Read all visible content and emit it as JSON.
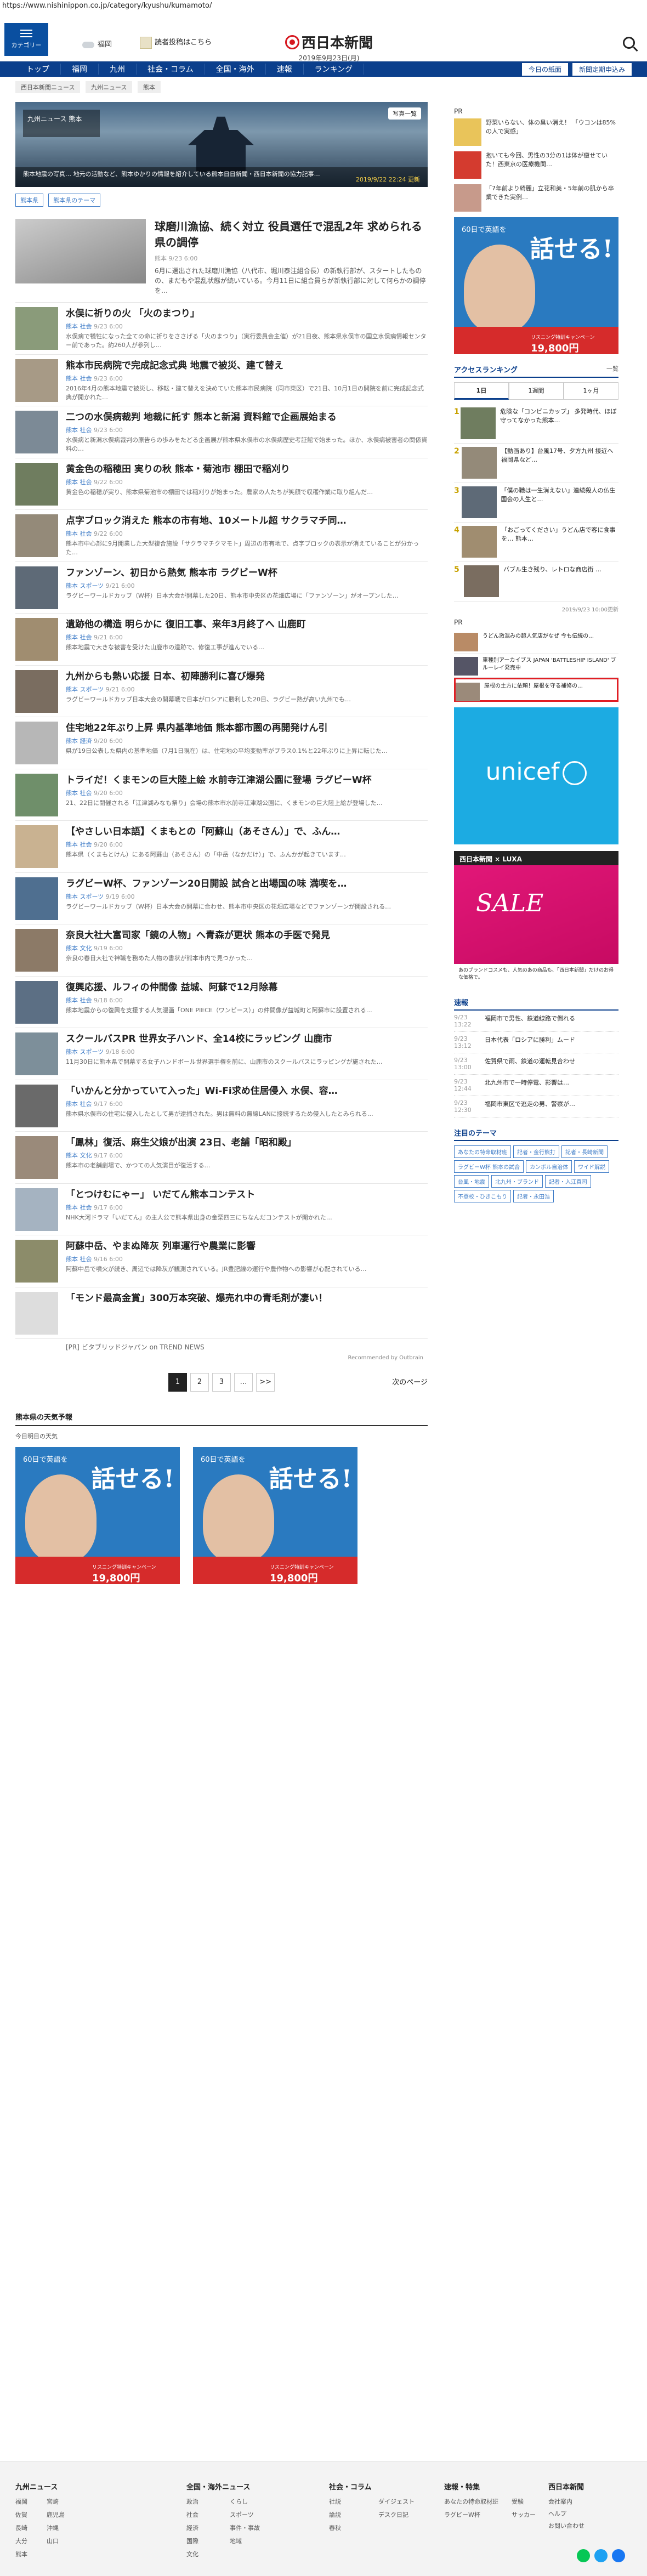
{
  "url": "https://www.nishinippon.co.jp/category/kyushu/kumamoto/",
  "header": {
    "category_label": "カテゴリー",
    "weather": "福岡",
    "ad_link": "読者投稿はこちら",
    "logo": "西日本新聞",
    "date": "2019年9月23日(月)"
  },
  "gnav": {
    "items": [
      "トップ",
      "福岡",
      "九州",
      "社会・コラム",
      "全国・海外",
      "速報",
      "ランキング"
    ],
    "right": [
      "今日の紙面",
      "新聞定期申込み"
    ]
  },
  "breadcrumb": [
    "西日本新聞ニュース",
    "九州ニュース",
    "熊本"
  ],
  "hero": {
    "tag": "九州ニュース 熊本",
    "photo_btn": "写真一覧",
    "caption": "熊本地震の写真… 地元の活動など、熊本ゆかりの情報を紹介している熊本日日新聞・西日本新聞の協力記事…",
    "date": "2019/9/22 22:24 更新"
  },
  "tags": [
    "熊本県",
    "熊本県のテーマ"
  ],
  "lead": {
    "title": "球磨川漁協、続く対立 役員選任で混乱2年 求められる県の調停",
    "meta": "熊本 9/23 6:00",
    "text": "6月に選出された球磨川漁協（八代市、堀川泰注組合長）の新執行部が、スタートしたものの、まだもや混乱状態が続いている。今月11日に組合員らが新執行部に対して何らかの調停を…"
  },
  "articles": [
    {
      "title": "水俣に祈りの火 「火のまつり」",
      "tag": "熊本",
      "cat": "社会",
      "time": "9/23 6:00",
      "text": "水俣病で犠牲になった全ての命に祈りをささげる「火のまつり」（実行委員会主催）が21日夜、熊本県水俣市の国立水俣病情報センター前であった。約260人が参列し…"
    },
    {
      "title": "熊本市民病院で完成記念式典 地震で被災、建て替え",
      "tag": "熊本",
      "cat": "社会",
      "time": "9/23 6:00",
      "text": "2016年4月の熊本地震で被災し、移転・建て替えを決めていた熊本市民病院（同市東区）で21日、10月1日の開院を前に完成記念式典が開かれた…"
    },
    {
      "title": "二つの水俣病裁判 地裁に託す 熊本と新潟 資料館で企画展始まる",
      "tag": "熊本",
      "cat": "社会",
      "time": "9/23 6:00",
      "text": "水俣病と新潟水俣病裁判の原告らの歩みをたどる企画展が熊本県水俣市の水俣病歴史考証館で始まった。ほか、水俣病被害者の関係資料の…"
    },
    {
      "title": "黄金色の稲穂田 実りの秋 熊本・菊池市 棚田で稲刈り",
      "tag": "熊本",
      "cat": "社会",
      "time": "9/22 6:00",
      "text": "黄金色の稲穂が実り、熊本県菊池市の棚田では稲刈りが始まった。農家の人たちが笑顔で収穫作業に取り組んだ…"
    },
    {
      "title": "点字ブロック消えた 熊本の市有地、10メートル超 サクラマチ同…",
      "tag": "熊本",
      "cat": "社会",
      "time": "9/22 6:00",
      "text": "熊本市中心部に9月開業した大型複合施設「サクラマチクマモト」周辺の市有地で、点字ブロックの表示が消えていることが分かった…"
    },
    {
      "title": "ファンゾーン、初日から熱気 熊本市 ラグビーW杯",
      "tag": "熊本",
      "cat": "スポーツ",
      "time": "9/21 6:00",
      "text": "ラグビーワールドカップ（W杯）日本大会が開幕した20日、熊本市中央区の花畑広場に「ファンゾーン」がオープンした…"
    },
    {
      "title": "遺跡他の構造 明らかに 復旧工事、来年3月終了へ 山鹿町",
      "tag": "熊本",
      "cat": "社会",
      "time": "9/21 6:00",
      "text": "熊本地震で大きな被害を受けた山鹿市の遺跡で、修復工事が進んでいる…"
    },
    {
      "title": "九州からも熱い応援 日本、初陣勝利に喜び爆発",
      "tag": "熊本",
      "cat": "スポーツ",
      "time": "9/21 6:00",
      "text": "ラグビーワールドカップ日本大会の開幕戦で日本がロシアに勝利した20日、ラグビー熱が高い九州でも…"
    },
    {
      "title": "住宅地22年ぶり上昇 県内基準地価 熊本都市圏の再開発けん引",
      "tag": "熊本",
      "cat": "経済",
      "time": "9/20 6:00",
      "text": "県が19日公表した県内の基準地価（7月1日現在）は、住宅地の平均変動率がプラス0.1%と22年ぶりに上昇に転じた…"
    },
    {
      "title": "トライだ！くまモンの巨大陸上絵 水前寺江津湖公園に登場 ラグビーW杯",
      "tag": "熊本",
      "cat": "社会",
      "time": "9/20 6:00",
      "text": "21、22日に開催される「江津湖みなも祭り」会場の熊本市水前寺江津湖公園に、くまモンの巨大陸上絵が登場した…"
    },
    {
      "title": "【やさしい日本語】くまもとの「阿蘇山（あそさん）」で、ふん…",
      "tag": "熊本",
      "cat": "社会",
      "time": "9/20 6:00",
      "text": "熊本県（くまもとけん）にある阿蘇山（あそさん）の「中岳（なかだけ）」で、ふんかが起きています…"
    },
    {
      "title": "ラグビーW杯、ファンゾーン20日開設 試合と出場国の味 満喫を…",
      "tag": "熊本",
      "cat": "スポーツ",
      "time": "9/19 6:00",
      "text": "ラグビーワールドカップ（W杯）日本大会の開幕に合わせ、熊本市中央区の花畑広場などでファンゾーンが開設される…"
    },
    {
      "title": "奈良大社大富司家「鏡の人物」へ青森が更状 熊本の手医で発見",
      "tag": "熊本",
      "cat": "文化",
      "time": "9/19 6:00",
      "text": "奈良の春日大社で神職を務めた人物の書状が熊本市内で見つかった…"
    },
    {
      "title": "復興応援、ルフィの仲間像 益城、阿蘇で12月除幕",
      "tag": "熊本",
      "cat": "社会",
      "time": "9/18 6:00",
      "text": "熊本地震からの復興を支援する人気漫画「ONE PIECE（ワンピース）」の仲間像が益城町と阿蘇市に設置される…"
    },
    {
      "title": "スクールバスPR 世界女子ハンド、全14校にラッピング 山鹿市",
      "tag": "熊本",
      "cat": "スポーツ",
      "time": "9/18 6:00",
      "text": "11月30日に熊本県で開幕する女子ハンドボール世界選手権を前に、山鹿市のスクールバスにラッピングが施された…"
    },
    {
      "title": "「いかんと分かっていて入った」Wi-Fi求め住居侵入 水俣、容…",
      "tag": "熊本",
      "cat": "社会",
      "time": "9/17 6:00",
      "text": "熊本県水俣市の住宅に侵入したとして男が逮捕された。男は無料の無線LANに接続するため侵入したとみられる…"
    },
    {
      "title": "「鳳林」復活、麻生父娘が出演 23日、老舗「昭和殿」",
      "tag": "熊本",
      "cat": "文化",
      "time": "9/17 6:00",
      "text": "熊本市の老舗劇場で、かつての人気演目が復活する…"
    },
    {
      "title": "「とつけむにゃー」 いだてん熊本コンテスト",
      "tag": "熊本",
      "cat": "社会",
      "time": "9/17 6:00",
      "text": "NHK大河ドラマ「いだてん」の主人公で熊本県出身の金栗四三にちなんだコンテストが開かれた…"
    },
    {
      "title": "阿蘇中岳、やまぬ降灰 列車運行や農業に影響",
      "tag": "熊本",
      "cat": "社会",
      "time": "9/16 6:00",
      "text": "阿蘇中岳で噴火が続き、周辺では降灰が観測されている。JR豊肥線の運行や農作物への影響が心配されている…"
    }
  ],
  "pr_article": {
    "title": "「モンド最高金賞」300万本突破、爆売れ中の青毛剤が凄い！",
    "source": "[PR] ビタブリッドジャパン on TREND NEWS"
  },
  "recommended": "Recommended by Outbrain",
  "pager": {
    "pages": [
      "1",
      "2",
      "3",
      "…",
      ">>"
    ],
    "next": "次のページ"
  },
  "pref": {
    "title": "熊本県の天気予報",
    "sub": "今日明日の天気"
  },
  "ad60": {
    "lead": "話せる!",
    "badge": "60日で英語を",
    "cta": "19,800円",
    "small": "リスニング特訓キャンペーン"
  },
  "side": {
    "pr_label": "PR",
    "pr_items": [
      "野菜いらない、体の臭い消え！ 「ウコンは85%の人で実感」",
      "抱いても今回、男性の3分の1は体が痩せていた！西東京の医療機関…",
      "「7年前より綺麗」立花和美・5年前の肌から卒業できた実例…"
    ],
    "ranking": {
      "title": "アクセスランキング",
      "more": "一覧",
      "tabs": [
        "1日",
        "1週間",
        "1ヶ月"
      ],
      "items": [
        "危険な「コンビニカップ」 多発時代、ほぼ守ってなかった熊本…",
        "【動画あり】台風17号、夕方九州 接近へ 福岡県など…",
        "「僕の職は一生消えない」連続殺人の仏生国会の人生と…",
        "「おごってください」うどん店で客に食事を… 熊本…",
        "バブル生き残り、レトロな商店街 …"
      ],
      "date": "2019/9/23 10:00更新"
    },
    "pr2": [
      "うどん激混みの超人気店がなぜ 今も伝統の…",
      "車種別アーカイブス JAPAN 'BATTLESHIP ISLAND' ブルーレイ発売中",
      "屋根の土方に依頼！屋根を守る補修の…"
    ],
    "unicef": "unicef",
    "luxa_head": "西日本新聞 × LUXA",
    "luxa_sale": "SALE",
    "luxa_foot": "あのブランドコスメも、人気のあの商品も、「西日本新聞」だけのお得な価格で。",
    "sokuho_title": "速報",
    "sokuho": [
      {
        "t": "9/23 13:22",
        "s": "福岡市で男性、鉄道線路で倒れる"
      },
      {
        "t": "9/23 13:12",
        "s": "日本代表「ロシアに勝利」ムード"
      },
      {
        "t": "9/23 13:00",
        "s": "佐賀県で雨、鉄道の運転見合わせ"
      },
      {
        "t": "9/23 12:44",
        "s": "北九州市で一時停電、影響は…"
      },
      {
        "t": "9/23 12:30",
        "s": "福岡市東区で逃走の男、警察が…"
      }
    ],
    "themes_title": "注目のテーマ",
    "themes": [
      "あなたの特命取材班",
      "記者・金行熊打",
      "記者・長崎新聞",
      "ラグビーW杯 熊本の試合",
      "カンボル自治体",
      "ワイド解説",
      "台風・地震",
      "北九州・ブランド",
      "記者・入江真司",
      "不登校・ひきこもり",
      "記者・永田浩"
    ]
  },
  "footer": {
    "cols": [
      {
        "h": "九州ニュース",
        "items": [
          "福岡",
          "佐賀",
          "長崎",
          "大分",
          "熊本",
          "宮崎",
          "鹿児島",
          "沖縄",
          "山口"
        ]
      },
      {
        "h": "全国・海外ニュース",
        "items": [
          "政治",
          "社会",
          "経済",
          "国際",
          "文化",
          "くらし",
          "スポーツ",
          "事件・事故",
          "地域"
        ]
      },
      {
        "h": "社会・コラム",
        "items": [
          "社説",
          "論説",
          "春秋",
          "ダイジェスト",
          "デスク日記"
        ]
      },
      {
        "h": "速報・特集",
        "items": [
          "あなたの特命取材班",
          "ラグビーW杯",
          "受験",
          "サッカー"
        ]
      }
    ],
    "logo": "西日本新聞",
    "links": [
      "会社案内",
      "ヘルプ",
      "お問い合わせ"
    ]
  }
}
